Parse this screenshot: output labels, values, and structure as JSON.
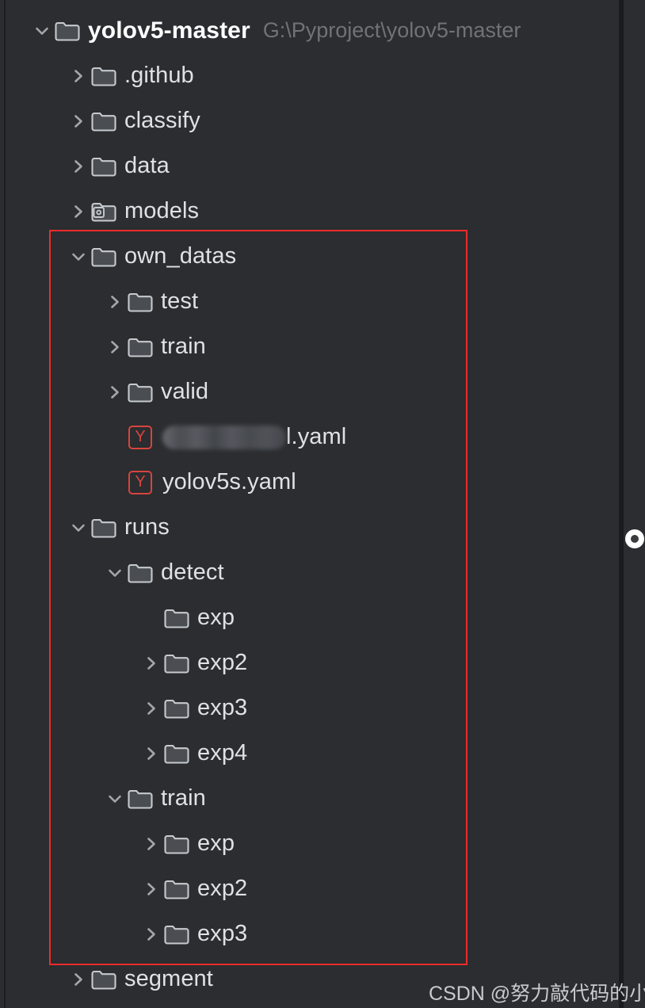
{
  "window": {
    "background_color": "#2b2d30",
    "annotation_color": "#ef2b2b",
    "accent_yaml_color": "#d7443e"
  },
  "project_root": {
    "label": "yolov5-master",
    "path": "G:\\Pyproject\\yolov5-master",
    "expanded": true
  },
  "tree": [
    {
      "label": "yolov5-master",
      "path": "G:\\Pyproject\\yolov5-master",
      "depth": 0,
      "state": "expanded",
      "icon": "folder-icon",
      "kind": "folder-root"
    },
    {
      "label": ".github",
      "path": "",
      "depth": 1,
      "state": "collapsed",
      "icon": "folder-icon",
      "kind": "folder"
    },
    {
      "label": "classify",
      "path": "",
      "depth": 1,
      "state": "collapsed",
      "icon": "folder-icon",
      "kind": "folder"
    },
    {
      "label": "data",
      "path": "",
      "depth": 1,
      "state": "collapsed",
      "icon": "folder-icon",
      "kind": "folder"
    },
    {
      "label": "models",
      "path": "",
      "depth": 1,
      "state": "collapsed",
      "icon": "python-package-folder-icon",
      "kind": "package"
    },
    {
      "label": "own_datas",
      "path": "",
      "depth": 1,
      "state": "expanded",
      "icon": "folder-icon",
      "kind": "folder"
    },
    {
      "label": "test",
      "path": "",
      "depth": 2,
      "state": "collapsed",
      "icon": "folder-icon",
      "kind": "folder"
    },
    {
      "label": "train",
      "path": "",
      "depth": 2,
      "state": "collapsed",
      "icon": "folder-icon",
      "kind": "folder"
    },
    {
      "label": "valid",
      "path": "",
      "depth": 2,
      "state": "collapsed",
      "icon": "folder-icon",
      "kind": "folder"
    },
    {
      "label": "l.yaml",
      "path": "",
      "depth": 2,
      "state": "leaf",
      "icon": "yaml-file-icon",
      "kind": "yaml",
      "redacted": true,
      "redacted_suffix": "l.yaml"
    },
    {
      "label": "yolov5s.yaml",
      "path": "",
      "depth": 2,
      "state": "leaf",
      "icon": "yaml-file-icon",
      "kind": "yaml"
    },
    {
      "label": "runs",
      "path": "",
      "depth": 1,
      "state": "expanded",
      "icon": "folder-icon",
      "kind": "folder"
    },
    {
      "label": "detect",
      "path": "",
      "depth": 2,
      "state": "expanded",
      "icon": "folder-icon",
      "kind": "folder"
    },
    {
      "label": "exp",
      "path": "",
      "depth": 3,
      "state": "leaf",
      "icon": "folder-icon",
      "kind": "folder"
    },
    {
      "label": "exp2",
      "path": "",
      "depth": 3,
      "state": "collapsed",
      "icon": "folder-icon",
      "kind": "folder"
    },
    {
      "label": "exp3",
      "path": "",
      "depth": 3,
      "state": "collapsed",
      "icon": "folder-icon",
      "kind": "folder"
    },
    {
      "label": "exp4",
      "path": "",
      "depth": 3,
      "state": "collapsed",
      "icon": "folder-icon",
      "kind": "folder"
    },
    {
      "label": "train",
      "path": "",
      "depth": 2,
      "state": "expanded",
      "icon": "folder-icon",
      "kind": "folder"
    },
    {
      "label": "exp",
      "path": "",
      "depth": 3,
      "state": "collapsed",
      "icon": "folder-icon",
      "kind": "folder"
    },
    {
      "label": "exp2",
      "path": "",
      "depth": 3,
      "state": "collapsed",
      "icon": "folder-icon",
      "kind": "folder"
    },
    {
      "label": "exp3",
      "path": "",
      "depth": 3,
      "state": "collapsed",
      "icon": "folder-icon",
      "kind": "folder"
    },
    {
      "label": "segment",
      "path": "",
      "depth": 1,
      "state": "collapsed",
      "icon": "folder-icon",
      "kind": "folder"
    }
  ],
  "yaml_badge_letter": "Y",
  "watermark": "CSDN @努力敲代码的小盆友"
}
